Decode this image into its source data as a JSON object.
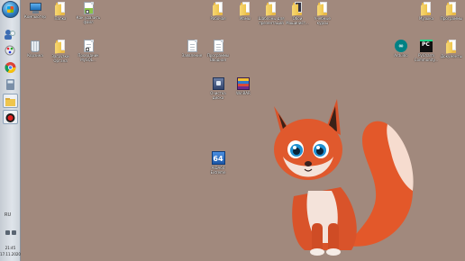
{
  "taskbar": {
    "language": "RU",
    "time": "21:45",
    "date": "17.11.2020"
  },
  "desktop": {
    "icons": [
      {
        "id": "computer",
        "label": "Компьютер"
      },
      {
        "id": "folder-1",
        "label": "Папка"
      },
      {
        "id": "file-1",
        "label": "Как удалить файл"
      },
      {
        "id": "folder-2",
        "label": "Рабочая"
      },
      {
        "id": "folder-3",
        "label": "Мамы"
      },
      {
        "id": "folder-4",
        "label": "Шаблоны для презентаций"
      },
      {
        "id": "folder-5",
        "label": "Обои Машинист..."
      },
      {
        "id": "folder-6",
        "label": "Учебные курсы"
      },
      {
        "id": "folder-7",
        "label": "Музыка"
      },
      {
        "id": "folder-8",
        "label": "Программы"
      },
      {
        "id": "trash",
        "label": "Корзина"
      },
      {
        "id": "folder-9",
        "label": "Загрузки Органа"
      },
      {
        "id": "file-2",
        "label": "Проводник MySQL..."
      },
      {
        "id": "doc-1",
        "label": "Заявление"
      },
      {
        "id": "doc-2",
        "label": "Программы Вводная"
      },
      {
        "id": "arduino",
        "label": "Arduino"
      },
      {
        "id": "pycharm",
        "label": "PyCharm Community..."
      },
      {
        "id": "folder-10",
        "label": "Документы"
      },
      {
        "id": "cleaner",
        "label": "Очистка диска"
      },
      {
        "id": "winrar",
        "label": "WinRAR"
      },
      {
        "id": "aida64",
        "label": "AIDA64 Extreme"
      }
    ]
  },
  "colors": {
    "desktop_bg": "#a1897d",
    "folder": "#eec54d"
  }
}
